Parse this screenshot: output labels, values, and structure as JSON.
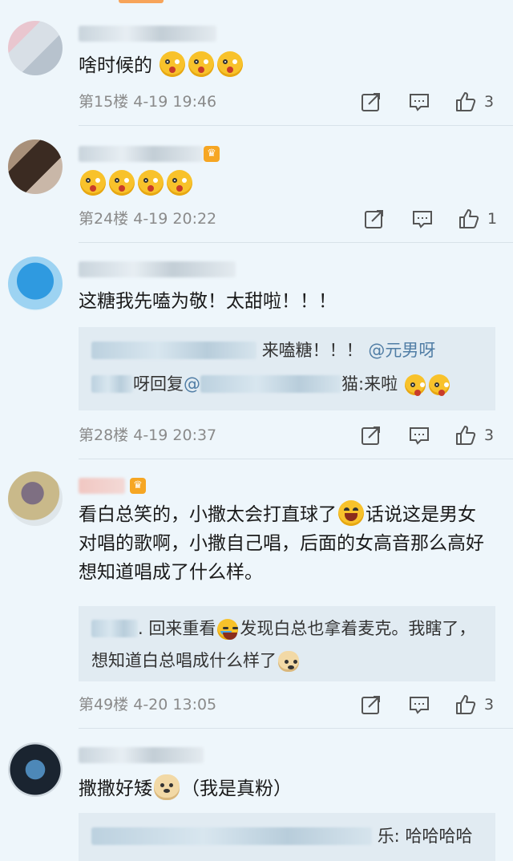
{
  "comments": [
    {
      "text": "啥时候的",
      "emojis": [
        "surprise-emoji",
        "surprise-emoji",
        "surprise-emoji"
      ],
      "floor": "第15楼",
      "time": "4-19 19:46",
      "likes": "3"
    },
    {
      "text": "",
      "emojis": [
        "surprise-emoji",
        "surprise-emoji",
        "surprise-emoji",
        "surprise-emoji"
      ],
      "floor": "第24楼",
      "time": "4-19 20:22",
      "likes": "1"
    },
    {
      "text": "这糖我先嗑为敬！太甜啦！！！",
      "reply_line1_tail": "来嗑糖！！！",
      "reply_line1_mention": "@元男呀",
      "reply_line2_mid": "呀回复",
      "reply_line2_mention": "@",
      "reply_line2_tail": "猫:来啦",
      "floor": "第28楼",
      "time": "4-19 20:37",
      "likes": "3"
    },
    {
      "text_part1": "看白总笑的，小撒太会打直球了",
      "text_part2": "话说这是男女对唱的歌啊，小撒自己唱，后面的女高音那么高好想知道唱成了什么样。",
      "reply_part1": ". 回来重看",
      "reply_part2": "发现白总也拿着麦克。我瞎了，想知道白总唱成什么样了",
      "floor": "第49楼",
      "time": "4-20 13:05",
      "likes": "3"
    },
    {
      "text_part1": "撒撒好矮",
      "text_part2": "（我是真粉）",
      "reply_tail": "乐: 哈哈哈哈"
    }
  ],
  "colors": {
    "link": "#507da5",
    "vip": "#f6a623",
    "accent": "#f7a45a"
  },
  "icons": [
    "share-icon",
    "comment-icon",
    "like-icon",
    "vip-crown-icon"
  ]
}
